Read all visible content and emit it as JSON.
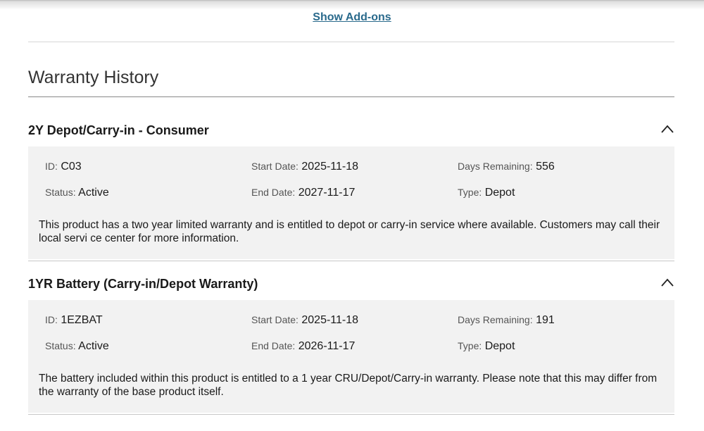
{
  "addons_link": "Show Add-ons",
  "page_title": "Warranty History",
  "labels": {
    "id": "ID:",
    "start": "Start Date:",
    "remaining": "Days Remaining:",
    "status": "Status:",
    "end": "End Date:",
    "type": "Type:"
  },
  "warranties": [
    {
      "title": "2Y Depot/Carry-in - Consumer",
      "id": "C03",
      "start_date": "2025-11-18",
      "days_remaining": "556",
      "status": "Active",
      "end_date": "2027-11-17",
      "type": "Depot",
      "description": "This product has a two year limited warranty and is entitled to depot or carry-in service where available. Customers may call their local servi ce center for more information."
    },
    {
      "title": "1YR Battery (Carry-in/Depot Warranty)",
      "id": "1EZBAT",
      "start_date": "2025-11-18",
      "days_remaining": "191",
      "status": "Active",
      "end_date": "2026-11-17",
      "type": "Depot",
      "description": "The battery included within this product is entitled to a 1 year CRU/Depot/Carry-in warranty. Please note that this may differ from the warranty of the base product itself."
    }
  ],
  "icons": {
    "collapse": "chevron-up-icon"
  }
}
